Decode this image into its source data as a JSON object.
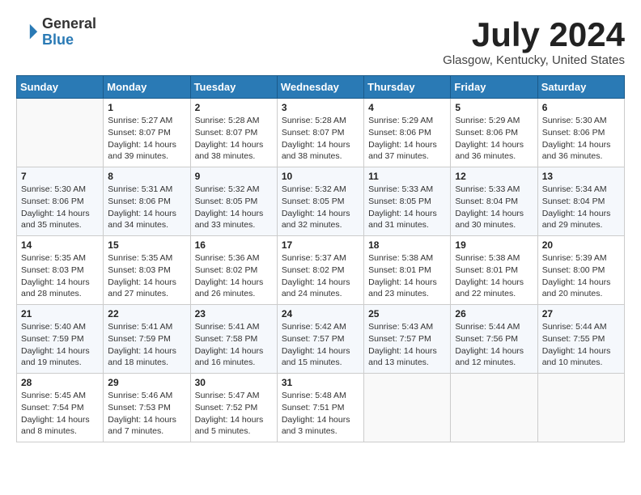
{
  "header": {
    "logo_line1": "General",
    "logo_line2": "Blue",
    "month_title": "July 2024",
    "location": "Glasgow, Kentucky, United States"
  },
  "weekdays": [
    "Sunday",
    "Monday",
    "Tuesday",
    "Wednesday",
    "Thursday",
    "Friday",
    "Saturday"
  ],
  "weeks": [
    [
      {
        "day": "",
        "info": ""
      },
      {
        "day": "1",
        "info": "Sunrise: 5:27 AM\nSunset: 8:07 PM\nDaylight: 14 hours\nand 39 minutes."
      },
      {
        "day": "2",
        "info": "Sunrise: 5:28 AM\nSunset: 8:07 PM\nDaylight: 14 hours\nand 38 minutes."
      },
      {
        "day": "3",
        "info": "Sunrise: 5:28 AM\nSunset: 8:07 PM\nDaylight: 14 hours\nand 38 minutes."
      },
      {
        "day": "4",
        "info": "Sunrise: 5:29 AM\nSunset: 8:06 PM\nDaylight: 14 hours\nand 37 minutes."
      },
      {
        "day": "5",
        "info": "Sunrise: 5:29 AM\nSunset: 8:06 PM\nDaylight: 14 hours\nand 36 minutes."
      },
      {
        "day": "6",
        "info": "Sunrise: 5:30 AM\nSunset: 8:06 PM\nDaylight: 14 hours\nand 36 minutes."
      }
    ],
    [
      {
        "day": "7",
        "info": "Sunrise: 5:30 AM\nSunset: 8:06 PM\nDaylight: 14 hours\nand 35 minutes."
      },
      {
        "day": "8",
        "info": "Sunrise: 5:31 AM\nSunset: 8:06 PM\nDaylight: 14 hours\nand 34 minutes."
      },
      {
        "day": "9",
        "info": "Sunrise: 5:32 AM\nSunset: 8:05 PM\nDaylight: 14 hours\nand 33 minutes."
      },
      {
        "day": "10",
        "info": "Sunrise: 5:32 AM\nSunset: 8:05 PM\nDaylight: 14 hours\nand 32 minutes."
      },
      {
        "day": "11",
        "info": "Sunrise: 5:33 AM\nSunset: 8:05 PM\nDaylight: 14 hours\nand 31 minutes."
      },
      {
        "day": "12",
        "info": "Sunrise: 5:33 AM\nSunset: 8:04 PM\nDaylight: 14 hours\nand 30 minutes."
      },
      {
        "day": "13",
        "info": "Sunrise: 5:34 AM\nSunset: 8:04 PM\nDaylight: 14 hours\nand 29 minutes."
      }
    ],
    [
      {
        "day": "14",
        "info": "Sunrise: 5:35 AM\nSunset: 8:03 PM\nDaylight: 14 hours\nand 28 minutes."
      },
      {
        "day": "15",
        "info": "Sunrise: 5:35 AM\nSunset: 8:03 PM\nDaylight: 14 hours\nand 27 minutes."
      },
      {
        "day": "16",
        "info": "Sunrise: 5:36 AM\nSunset: 8:02 PM\nDaylight: 14 hours\nand 26 minutes."
      },
      {
        "day": "17",
        "info": "Sunrise: 5:37 AM\nSunset: 8:02 PM\nDaylight: 14 hours\nand 24 minutes."
      },
      {
        "day": "18",
        "info": "Sunrise: 5:38 AM\nSunset: 8:01 PM\nDaylight: 14 hours\nand 23 minutes."
      },
      {
        "day": "19",
        "info": "Sunrise: 5:38 AM\nSunset: 8:01 PM\nDaylight: 14 hours\nand 22 minutes."
      },
      {
        "day": "20",
        "info": "Sunrise: 5:39 AM\nSunset: 8:00 PM\nDaylight: 14 hours\nand 20 minutes."
      }
    ],
    [
      {
        "day": "21",
        "info": "Sunrise: 5:40 AM\nSunset: 7:59 PM\nDaylight: 14 hours\nand 19 minutes."
      },
      {
        "day": "22",
        "info": "Sunrise: 5:41 AM\nSunset: 7:59 PM\nDaylight: 14 hours\nand 18 minutes."
      },
      {
        "day": "23",
        "info": "Sunrise: 5:41 AM\nSunset: 7:58 PM\nDaylight: 14 hours\nand 16 minutes."
      },
      {
        "day": "24",
        "info": "Sunrise: 5:42 AM\nSunset: 7:57 PM\nDaylight: 14 hours\nand 15 minutes."
      },
      {
        "day": "25",
        "info": "Sunrise: 5:43 AM\nSunset: 7:57 PM\nDaylight: 14 hours\nand 13 minutes."
      },
      {
        "day": "26",
        "info": "Sunrise: 5:44 AM\nSunset: 7:56 PM\nDaylight: 14 hours\nand 12 minutes."
      },
      {
        "day": "27",
        "info": "Sunrise: 5:44 AM\nSunset: 7:55 PM\nDaylight: 14 hours\nand 10 minutes."
      }
    ],
    [
      {
        "day": "28",
        "info": "Sunrise: 5:45 AM\nSunset: 7:54 PM\nDaylight: 14 hours\nand 8 minutes."
      },
      {
        "day": "29",
        "info": "Sunrise: 5:46 AM\nSunset: 7:53 PM\nDaylight: 14 hours\nand 7 minutes."
      },
      {
        "day": "30",
        "info": "Sunrise: 5:47 AM\nSunset: 7:52 PM\nDaylight: 14 hours\nand 5 minutes."
      },
      {
        "day": "31",
        "info": "Sunrise: 5:48 AM\nSunset: 7:51 PM\nDaylight: 14 hours\nand 3 minutes."
      },
      {
        "day": "",
        "info": ""
      },
      {
        "day": "",
        "info": ""
      },
      {
        "day": "",
        "info": ""
      }
    ]
  ]
}
